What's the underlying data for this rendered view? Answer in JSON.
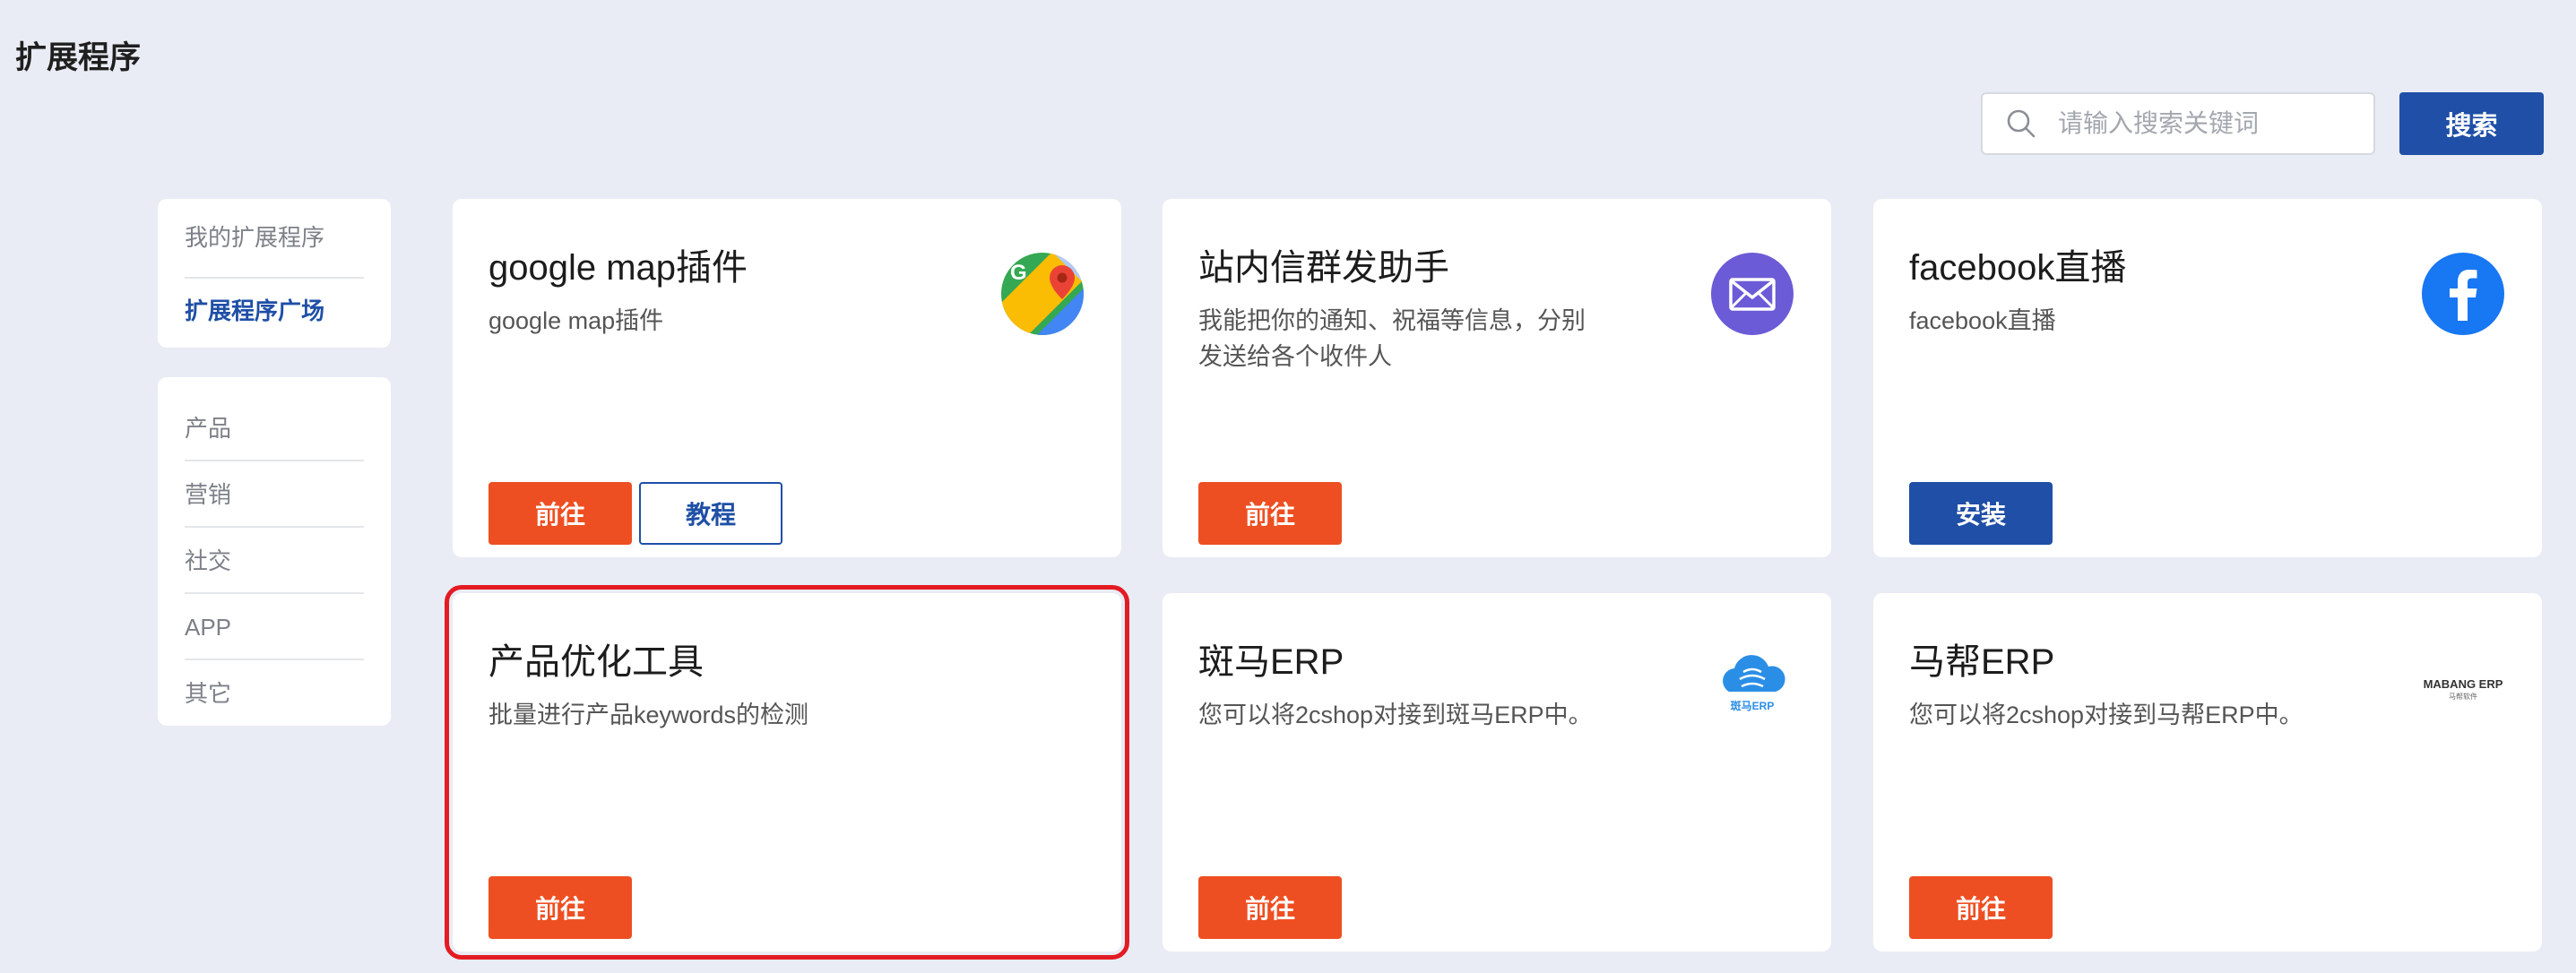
{
  "page": {
    "title": "扩展程序"
  },
  "search": {
    "placeholder": "请输入搜索关键词",
    "button_label": "搜索"
  },
  "sidebar": {
    "top_items": [
      {
        "label": "我的扩展程序",
        "active": false
      },
      {
        "label": "扩展程序广场",
        "active": true
      }
    ],
    "categories": [
      "产品",
      "营销",
      "社交",
      "APP",
      "其它"
    ]
  },
  "cards": [
    {
      "title": "google map插件",
      "desc": "google map插件",
      "icon": "google-maps-icon",
      "buttons": [
        "前往",
        "教程"
      ]
    },
    {
      "title": "站内信群发助手",
      "desc": "我能把你的通知、祝福等信息，分别发送给各个收件人",
      "icon": "mail-icon",
      "buttons": [
        "前往"
      ]
    },
    {
      "title": "facebook直播",
      "desc": "facebook直播",
      "icon": "facebook-icon",
      "buttons": [
        "安装"
      ]
    },
    {
      "title": "产品优化工具",
      "desc": "批量进行产品keywords的检测",
      "icon": "",
      "buttons": [
        "前往"
      ]
    },
    {
      "title": "斑马ERP",
      "desc": "您可以将2cshop对接到斑马ERP中。",
      "icon": "zebra-erp-logo",
      "logo_text": "斑马ERP",
      "buttons": [
        "前往"
      ]
    },
    {
      "title": "马帮ERP",
      "desc": "您可以将2cshop对接到马帮ERP中。",
      "icon": "mabang-erp-logo",
      "logo_text": "MABANG ERP",
      "logo_subtext": "马帮软件",
      "buttons": [
        "前往"
      ]
    }
  ],
  "colors": {
    "background": "#e9ecf4",
    "primary_orange": "#ee4f22",
    "primary_blue": "#1f4fa6",
    "selection_red": "#e31b23",
    "mail_purple": "#6b5bd6",
    "facebook_blue": "#1877f2"
  }
}
